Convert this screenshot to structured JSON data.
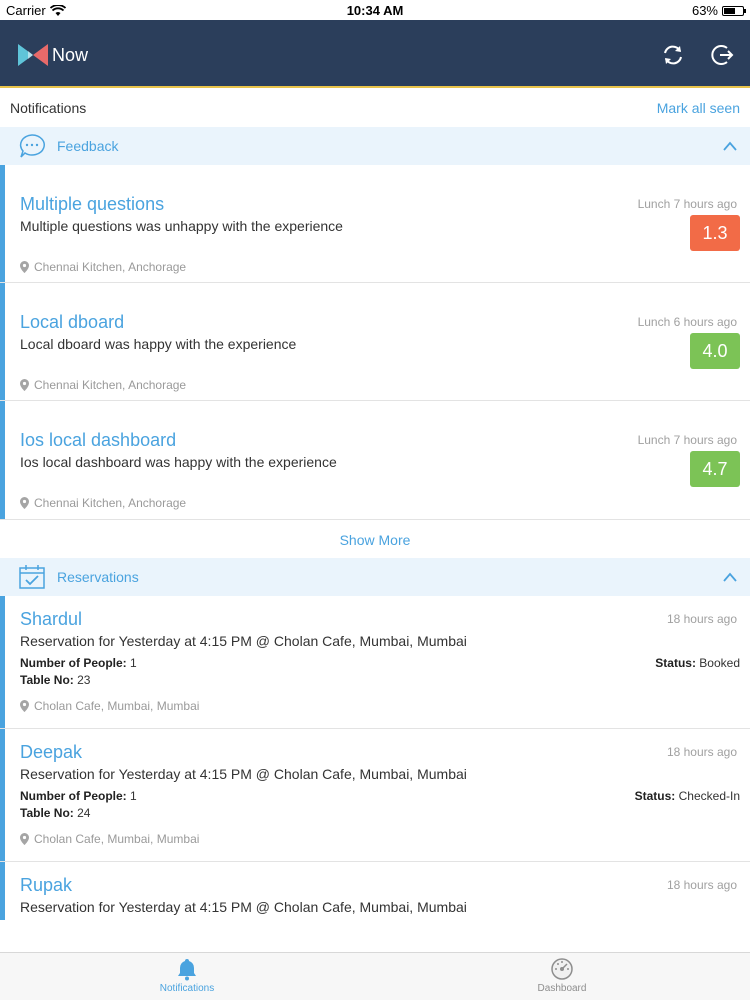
{
  "status_bar": {
    "carrier": "Carrier",
    "time": "10:34 AM",
    "battery": "63%",
    "battery_level": 0.63
  },
  "header": {
    "brand": "Now"
  },
  "notifications_bar": {
    "title": "Notifications",
    "mark_all_seen": "Mark all seen"
  },
  "feedback": {
    "label": "Feedback",
    "items": [
      {
        "name": "Multiple questions",
        "desc": "Multiple questions was unhappy with the experience",
        "time": "Lunch 7 hours ago",
        "score": "1.3",
        "score_color": "#f26b47",
        "location": "Chennai Kitchen, Anchorage"
      },
      {
        "name": "Local dboard",
        "desc": "Local dboard was happy with the experience",
        "time": "Lunch 6 hours ago",
        "score": "4.0",
        "score_color": "#7cc356",
        "location": "Chennai Kitchen, Anchorage"
      },
      {
        "name": "Ios local dashboard",
        "desc": "Ios local dashboard was happy with the experience",
        "time": "Lunch 7 hours ago",
        "score": "4.7",
        "score_color": "#7cc356",
        "location": "Chennai Kitchen, Anchorage"
      }
    ],
    "show_more": "Show More"
  },
  "reservations": {
    "label": "Reservations",
    "people_label": "Number of People:",
    "table_label": "Table No:",
    "status_label": "Status:",
    "items": [
      {
        "name": "Shardul",
        "desc": "Reservation for Yesterday at 4:15 PM @ Cholan Cafe, Mumbai, Mumbai",
        "time": "18 hours ago",
        "people": "1",
        "table": "23",
        "status": "Booked",
        "location": "Cholan Cafe, Mumbai, Mumbai"
      },
      {
        "name": "Deepak",
        "desc": "Reservation for Yesterday at 4:15 PM @ Cholan Cafe, Mumbai, Mumbai",
        "time": "18 hours ago",
        "people": "1",
        "table": "24",
        "status": "Checked-In",
        "location": "Cholan Cafe, Mumbai, Mumbai"
      },
      {
        "name": "Rupak",
        "desc": "Reservation for Yesterday at 4:15 PM @ Cholan Cafe, Mumbai, Mumbai",
        "time": "18 hours ago"
      }
    ]
  },
  "tabs": [
    {
      "label": "Notifications",
      "active": true
    },
    {
      "label": "Dashboard",
      "active": false
    }
  ],
  "colors": {
    "accent": "#4aa3df",
    "header_bg": "#2b3e5b",
    "section_bg": "#eaf4fc",
    "active_tab": "#4aa3df",
    "inactive_tab": "#8e8e8e"
  }
}
